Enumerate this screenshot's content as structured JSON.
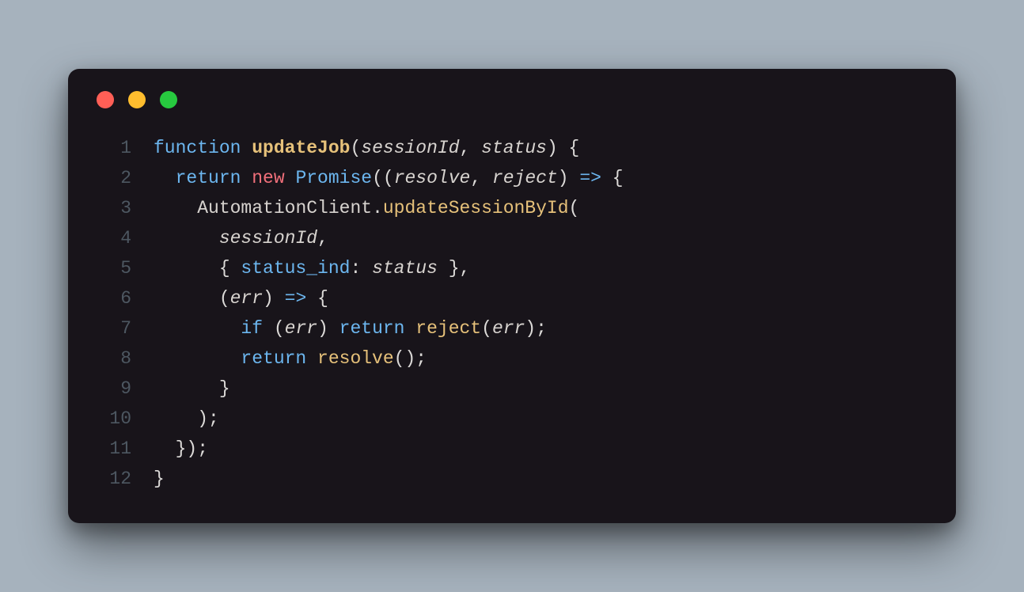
{
  "window": {
    "traffic_lights": [
      "close",
      "minimize",
      "zoom"
    ]
  },
  "colors": {
    "background": "#a6b2bd",
    "editor_bg": "#18141a",
    "red": "#ff5f56",
    "yellow": "#ffbd2e",
    "green": "#27c93f",
    "keyword": "#6cb6ef",
    "function_name": "#e6c17a",
    "new_keyword": "#f06f7a",
    "line_number": "#4d5761",
    "default_text": "#dcdad8"
  },
  "code": {
    "language": "javascript",
    "line_numbers": [
      "1",
      "2",
      "3",
      "4",
      "5",
      "6",
      "7",
      "8",
      "9",
      "10",
      "11",
      "12"
    ],
    "tokens": [
      [
        {
          "t": "function ",
          "c": "kw"
        },
        {
          "t": "updateJob",
          "c": "fn-name"
        },
        {
          "t": "(",
          "c": "punc"
        },
        {
          "t": "sessionId",
          "c": "param"
        },
        {
          "t": ", ",
          "c": "punc"
        },
        {
          "t": "status",
          "c": "param"
        },
        {
          "t": ") {",
          "c": "punc"
        }
      ],
      [
        {
          "t": "  ",
          "c": "punc"
        },
        {
          "t": "return ",
          "c": "kw"
        },
        {
          "t": "new ",
          "c": "new-kw"
        },
        {
          "t": "Promise",
          "c": "cls"
        },
        {
          "t": "((",
          "c": "punc"
        },
        {
          "t": "resolve",
          "c": "param"
        },
        {
          "t": ", ",
          "c": "punc"
        },
        {
          "t": "reject",
          "c": "param"
        },
        {
          "t": ") ",
          "c": "punc"
        },
        {
          "t": "=>",
          "c": "arrow"
        },
        {
          "t": " {",
          "c": "punc"
        }
      ],
      [
        {
          "t": "    ",
          "c": "punc"
        },
        {
          "t": "AutomationClient",
          "c": "ident"
        },
        {
          "t": ".",
          "c": "punc"
        },
        {
          "t": "updateSessionById",
          "c": "method"
        },
        {
          "t": "(",
          "c": "punc"
        }
      ],
      [
        {
          "t": "      ",
          "c": "punc"
        },
        {
          "t": "sessionId",
          "c": "param"
        },
        {
          "t": ",",
          "c": "punc"
        }
      ],
      [
        {
          "t": "      { ",
          "c": "punc"
        },
        {
          "t": "status_ind",
          "c": "prop"
        },
        {
          "t": ": ",
          "c": "punc"
        },
        {
          "t": "status",
          "c": "param"
        },
        {
          "t": " },",
          "c": "punc"
        }
      ],
      [
        {
          "t": "      (",
          "c": "punc"
        },
        {
          "t": "err",
          "c": "param"
        },
        {
          "t": ") ",
          "c": "punc"
        },
        {
          "t": "=>",
          "c": "arrow"
        },
        {
          "t": " {",
          "c": "punc"
        }
      ],
      [
        {
          "t": "        ",
          "c": "punc"
        },
        {
          "t": "if",
          "c": "kw"
        },
        {
          "t": " (",
          "c": "punc"
        },
        {
          "t": "err",
          "c": "param"
        },
        {
          "t": ") ",
          "c": "punc"
        },
        {
          "t": "return ",
          "c": "kw"
        },
        {
          "t": "reject",
          "c": "method"
        },
        {
          "t": "(",
          "c": "punc"
        },
        {
          "t": "err",
          "c": "param"
        },
        {
          "t": ");",
          "c": "punc"
        }
      ],
      [
        {
          "t": "        ",
          "c": "punc"
        },
        {
          "t": "return ",
          "c": "kw"
        },
        {
          "t": "resolve",
          "c": "method"
        },
        {
          "t": "();",
          "c": "punc"
        }
      ],
      [
        {
          "t": "      }",
          "c": "punc"
        }
      ],
      [
        {
          "t": "    );",
          "c": "punc"
        }
      ],
      [
        {
          "t": "  });",
          "c": "punc"
        }
      ],
      [
        {
          "t": "}",
          "c": "punc"
        }
      ]
    ]
  }
}
